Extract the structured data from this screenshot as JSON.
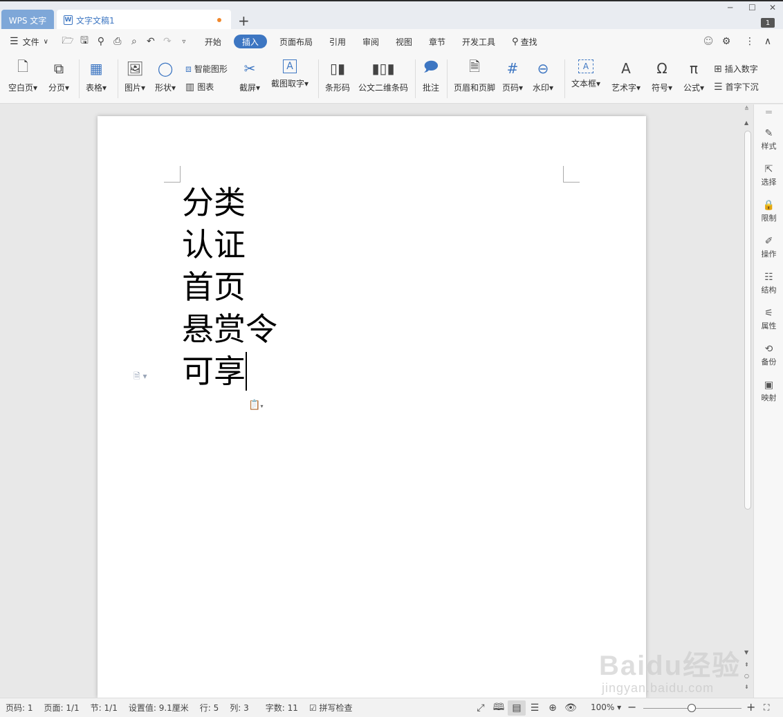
{
  "titlebar": {
    "app_tab": "WPS 文字",
    "doc_icon": "W",
    "doc_tab": "文字文稿1",
    "new_tab": "+",
    "badge": "1"
  },
  "menubar": {
    "file_label": "文件",
    "tabs": [
      "开始",
      "插入",
      "页面布局",
      "引用",
      "审阅",
      "视图",
      "章节",
      "开发工具"
    ],
    "search_label": "查找"
  },
  "ribbon": {
    "blank_page": "空白页",
    "page_break": "分页",
    "table": "表格",
    "picture": "图片",
    "shape": "形状",
    "smart_art": "智能图形",
    "chart": "图表",
    "screenshot": "截屏",
    "ocr": "截图取字",
    "barcode": "条形码",
    "qrcode": "公文二维条码",
    "comment": "批注",
    "header_footer": "页眉和页脚",
    "page_number": "页码",
    "watermark": "水印",
    "textbox": "文本框",
    "wordart": "艺术字",
    "symbol": "符号",
    "formula": "公式",
    "insert_number": "插入数字",
    "drop_cap": "首字下沉"
  },
  "document": {
    "lines": [
      "分类",
      "认证",
      "首页",
      "悬赏令",
      "可享"
    ]
  },
  "sidebar": {
    "items": [
      "样式",
      "选择",
      "限制",
      "操作",
      "结构",
      "属性",
      "备份",
      "映射"
    ]
  },
  "statusbar": {
    "page_num": "页码: 1",
    "pages": "页面: 1/1",
    "section": "节: 1/1",
    "setting": "设置值: 9.1厘米",
    "row": "行: 5",
    "col": "列: 3",
    "word_count": "字数: 11",
    "spell_check": "拼写检查",
    "zoom": "100%"
  },
  "watermark": {
    "logo": "Baidu经验",
    "url": "jingyan.baidu.com"
  }
}
